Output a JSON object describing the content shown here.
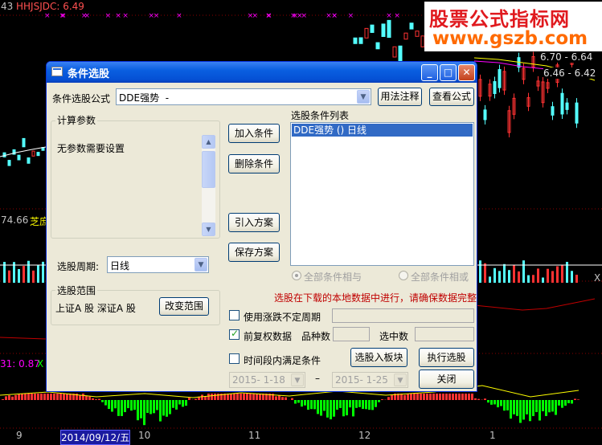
{
  "background": {
    "header_left": "43",
    "header_indicator": "HHJSJDC: 6.49",
    "price_tag_1": "6.70 - 6.64",
    "price_tag_2": "6.46 - 6.42",
    "left_value": "74.66",
    "left_value_suffix": "芝庶",
    "lower_indicator": "31: 0.87",
    "lower_indicator_suffix": "X",
    "right_marker": "X",
    "axis_labels": [
      "9",
      "2014/09/12/五",
      "10",
      "11",
      "12",
      "1"
    ],
    "colors": {
      "up": "#ff3232",
      "down": "#54ffff",
      "volume_green": "#00ff00",
      "magenta": "#ff00ff"
    }
  },
  "watermark": {
    "title": "股票公式指标网",
    "url": "www.gszb.com"
  },
  "dialog": {
    "title": "条件选股",
    "window_buttons": {
      "minimize": "_",
      "maximize": "□",
      "close": "✕"
    },
    "formula_label": "条件选股公式",
    "formula_value": "DDE强势  -",
    "help_button": "用法注释",
    "view_formula_button": "查看公式",
    "calc_params": {
      "title": "计算参数",
      "text": "无参数需要设置"
    },
    "period_label": "选股周期:",
    "period_value": "日线",
    "scope": {
      "title": "选股范围",
      "text": "上证A 股  深证A 股",
      "change_button": "改变范围"
    },
    "buttons": {
      "add_condition": "加入条件",
      "delete_condition": "删除条件",
      "import_plan": "引入方案",
      "save_plan": "保存方案",
      "select_to_block": "选股入板块",
      "run_selection": "执行选股",
      "close": "关闭"
    },
    "condition_list": {
      "title": "选股条件列表",
      "items": [
        "DDE强势  () 日线"
      ]
    },
    "logic": {
      "all_and": "全部条件相与",
      "all_or": "全部条件相或"
    },
    "notice": "选股在下载的本地数据中进行，请确保数据完整",
    "options": {
      "variable_period": "使用涨跌不定周期",
      "pre_adjust": "前复权数据",
      "stock_count_label": "品种数",
      "selected_count_label": "选中数",
      "time_range": "时间段内满足条件"
    },
    "date_from": "2015- 1-18",
    "date_dash": "–",
    "date_to": "2015- 1-25"
  }
}
